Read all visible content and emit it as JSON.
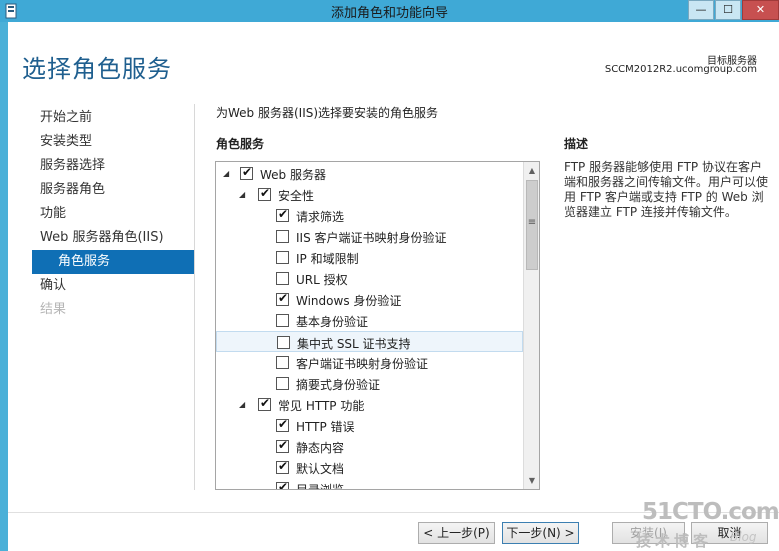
{
  "window": {
    "title": "添加角色和功能向导",
    "min_glyph": "—",
    "max_glyph": "☐",
    "close_glyph": "✕",
    "app_icon": "server-manager-icon"
  },
  "header": {
    "page_title": "选择角色服务",
    "dest_label": "目标服务器",
    "dest_server": "SCCM2012R2.ucomgroup.com"
  },
  "nav": {
    "items": [
      {
        "label": "开始之前",
        "state": "normal"
      },
      {
        "label": "安装类型",
        "state": "normal"
      },
      {
        "label": "服务器选择",
        "state": "normal"
      },
      {
        "label": "服务器角色",
        "state": "normal"
      },
      {
        "label": "功能",
        "state": "normal"
      },
      {
        "label": "Web 服务器角色(IIS)",
        "state": "normal"
      },
      {
        "label": "角色服务",
        "state": "active"
      },
      {
        "label": "确认",
        "state": "normal"
      },
      {
        "label": "结果",
        "state": "disabled"
      }
    ]
  },
  "main": {
    "instruction": "为Web 服务器(IIS)选择要安装的角色服务",
    "tree_heading": "角色服务",
    "tree": [
      {
        "label": "Web 服务器",
        "level": 0,
        "checked": true,
        "expanded": true
      },
      {
        "label": "安全性",
        "level": 1,
        "checked": true,
        "expanded": true
      },
      {
        "label": "请求筛选",
        "level": 2,
        "checked": true
      },
      {
        "label": "IIS 客户端证书映射身份验证",
        "level": 2,
        "checked": false
      },
      {
        "label": "IP 和域限制",
        "level": 2,
        "checked": false
      },
      {
        "label": "URL 授权",
        "level": 2,
        "checked": false
      },
      {
        "label": "Windows 身份验证",
        "level": 2,
        "checked": true
      },
      {
        "label": "基本身份验证",
        "level": 2,
        "checked": false
      },
      {
        "label": "集中式 SSL 证书支持",
        "level": 2,
        "checked": false,
        "selected": true
      },
      {
        "label": "客户端证书映射身份验证",
        "level": 2,
        "checked": false
      },
      {
        "label": "摘要式身份验证",
        "level": 2,
        "checked": false
      },
      {
        "label": "常见 HTTP 功能",
        "level": 1,
        "checked": true,
        "expanded": true
      },
      {
        "label": "HTTP 错误",
        "level": 2,
        "checked": true
      },
      {
        "label": "静态内容",
        "level": 2,
        "checked": true
      },
      {
        "label": "默认文档",
        "level": 2,
        "checked": true
      },
      {
        "label": "目录浏览",
        "level": 2,
        "checked": true
      }
    ],
    "check_glyph": "✔",
    "expanded_glyph": "◢",
    "scroll_up_glyph": "▲",
    "scroll_down_glyph": "▼",
    "scroll_grip_glyph": "≡"
  },
  "description": {
    "heading": "描述",
    "text": "FTP 服务器能够使用 FTP 协议在客户端和服务器之间传输文件。用户可以使用 FTP 客户端或支持 FTP 的 Web 浏览器建立 FTP 连接并传输文件。"
  },
  "footer": {
    "prev_label": "< 上一步(P)",
    "next_label": "下一步(N) >",
    "install_label": "安装(I)",
    "cancel_label": "取消"
  },
  "watermark": {
    "main": "51CTO.com",
    "sub": "技术博客",
    "blog": "Blog"
  }
}
